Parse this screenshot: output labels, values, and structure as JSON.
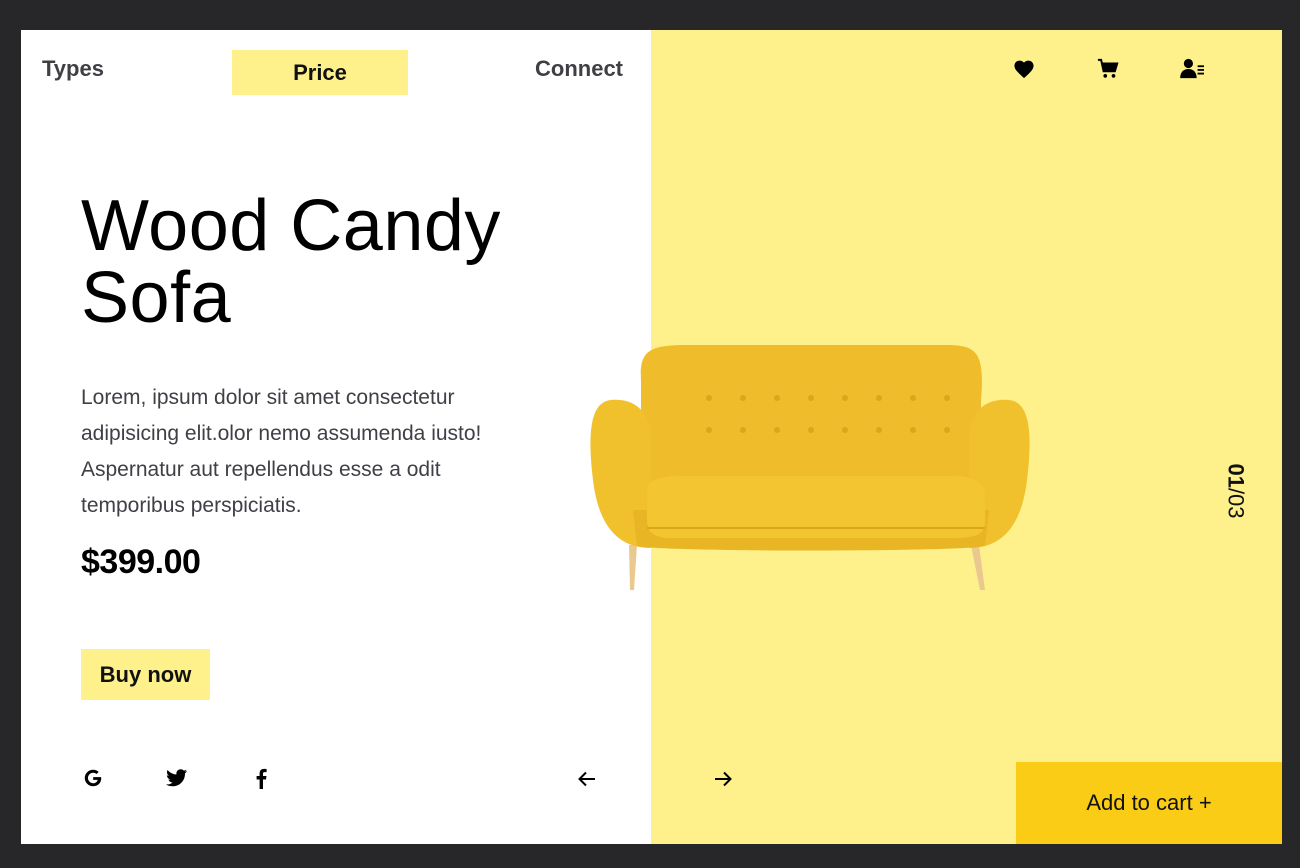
{
  "nav": {
    "types": "Types",
    "price": "Price",
    "connect": "Connect"
  },
  "header_icons": [
    "heart-icon",
    "cart-icon",
    "user-list-icon"
  ],
  "product": {
    "title_line1": "Wood Candy",
    "title_line2": "Sofa",
    "description": "Lorem, ipsum dolor sit amet consectetur adipisicing elit.olor nemo assumenda iusto! Aspernatur aut repellendus esse a odit temporibus perspiciatis.",
    "price": "$399.00",
    "buy_label": "Buy now",
    "add_to_cart_label": "Add to cart +"
  },
  "slider": {
    "current": "01",
    "total": "/03"
  },
  "social_icons": [
    "google-icon",
    "twitter-icon",
    "facebook-icon"
  ],
  "colors": {
    "background": "#27272a",
    "accent_light": "#fef08a",
    "accent_strong": "#facc15",
    "sofa": "#f2c22e"
  }
}
